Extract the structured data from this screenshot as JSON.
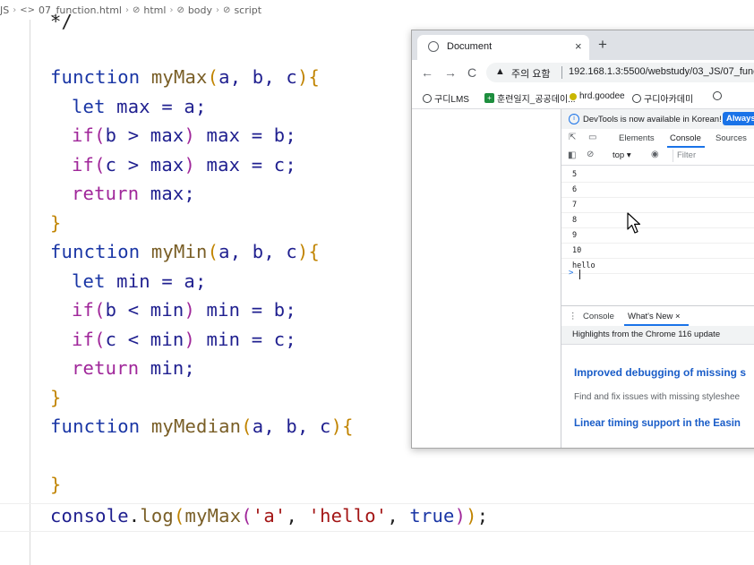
{
  "breadcrumb": {
    "items": [
      "JS",
      "07_function.html",
      "html",
      "body",
      "script"
    ]
  },
  "editor": {
    "lines": {
      "l0": "*/",
      "l1_kw": "function",
      "l1_fn": "myMax",
      "l1_params": "a, b, c",
      "l2_kw": "let",
      "l2_rest": " max = a;",
      "l3_kw": "if",
      "l3_cond": "b > max",
      "l3_rest": " max = b;",
      "l4_kw": "if",
      "l4_cond": "c > max",
      "l4_rest": " max = c;",
      "l5_kw": "return",
      "l5_rest": " max;",
      "l6": "}",
      "l7_kw": "function",
      "l7_fn": "myMin",
      "l7_params": "a, b, c",
      "l8_kw": "let",
      "l8_rest": " min = a;",
      "l9_kw": "if",
      "l9_cond": "b < min",
      "l9_rest": " min = b;",
      "l10_kw": "if",
      "l10_cond": "c < min",
      "l10_rest": " min = c;",
      "l11_kw": "return",
      "l11_rest": " min;",
      "l12": "}",
      "l13_kw": "function",
      "l13_fn": "myMedian",
      "l13_params": "a, b, c",
      "l15": "}",
      "l16_obj": "console",
      "l16_method": "log",
      "l16_fn": "myMax",
      "l16_s1": "'a'",
      "l16_s2": "'hello'",
      "l16_bool": "true"
    }
  },
  "browser": {
    "tab_title": "Document",
    "security_label": "주의 요함",
    "url": "192.168.1.3:5500/webstudy/03_JS/07_func",
    "bookmarks": [
      "구디LMS",
      "훈련일지_공공데이...",
      "hrd.goodee",
      "구디아카데미"
    ],
    "devtools": {
      "notice": "DevTools is now available in Korean!",
      "notice_button": "Always",
      "tabs": [
        "Elements",
        "Console",
        "Sources"
      ],
      "context": "top",
      "filter_placeholder": "Filter",
      "console_output": [
        "5",
        "6",
        "7",
        "8",
        "9",
        "10",
        "hello"
      ],
      "prompt": ">",
      "drawer_tabs": [
        "Console",
        "What's New"
      ],
      "whats_new_header": "Highlights from the Chrome 116 update",
      "whats_new_h1": "Improved debugging of missing s",
      "whats_new_p": "Find and fix issues with missing styleshee",
      "whats_new_h2": "Linear timing support in the Easin"
    }
  }
}
